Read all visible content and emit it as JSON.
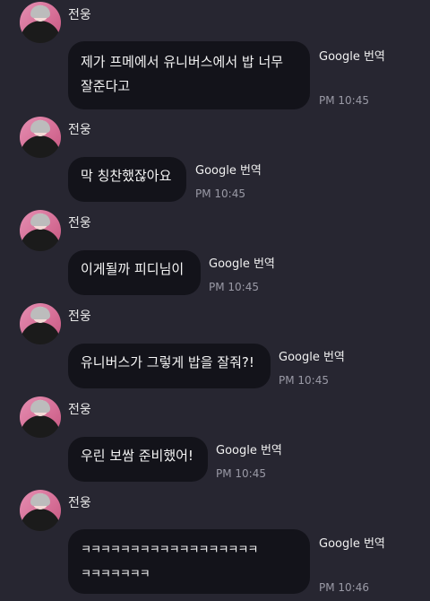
{
  "messages": [
    {
      "sender": "전웅",
      "text_lines": [
        "제가 프메에서 유니버스에서 밥 너무",
        "잘준다고"
      ],
      "translate_label": "Google 번역",
      "time": "PM 10:45"
    },
    {
      "sender": "전웅",
      "text_lines": [
        "막 칭찬했잖아요"
      ],
      "translate_label": "Google 번역",
      "time": "PM 10:45"
    },
    {
      "sender": "전웅",
      "text_lines": [
        "이게될까 피디님이"
      ],
      "translate_label": "Google 번역",
      "time": "PM 10:45"
    },
    {
      "sender": "전웅",
      "text_lines": [
        "유니버스가 그렇게 밥을 잘줘?!"
      ],
      "translate_label": "Google 번역",
      "time": "PM 10:45"
    },
    {
      "sender": "전웅",
      "text_lines": [
        "우린 보쌈 준비했어!"
      ],
      "translate_label": "Google 번역",
      "time": "PM 10:45"
    },
    {
      "sender": "전웅",
      "text_lines": [
        "ㅋㅋㅋㅋㅋㅋㅋㅋㅋㅋㅋㅋㅋㅋㅋㅋㅋㅋ",
        "ㅋㅋㅋㅋㅋㅋㅋ"
      ],
      "translate_label": "Google 번역",
      "time": "PM 10:46"
    }
  ]
}
